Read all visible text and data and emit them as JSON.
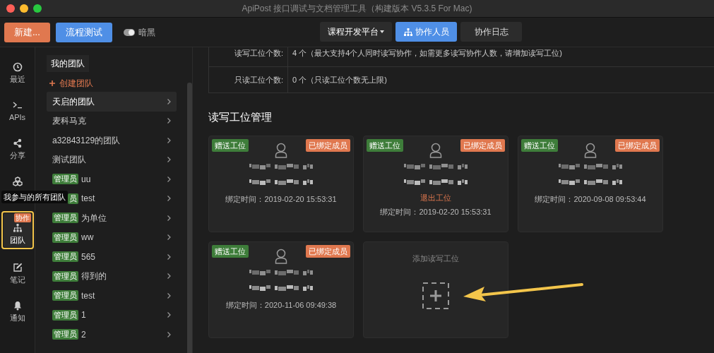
{
  "window": {
    "title": "ApiPost 接口调试与文档管理工具（构建版本 V5.3.5 For Mac)"
  },
  "toolbar": {
    "new_button": "新建...",
    "flow_button": "流程测试",
    "dark_toggle": {
      "label": "暗黑",
      "on": true
    },
    "project_select": "课程开发平台",
    "tabs": [
      {
        "label": "协作人员",
        "selected": true
      },
      {
        "label": "协作日志",
        "selected": false
      }
    ]
  },
  "rail": [
    {
      "kind": "clock",
      "label": "最近",
      "selected": false
    },
    {
      "kind": "terminal",
      "label": "APIs",
      "selected": false
    },
    {
      "kind": "share",
      "label": "分享",
      "selected": false
    },
    {
      "kind": "cubes",
      "selected": false
    },
    {
      "kind": "team",
      "label": "团队",
      "badge": "协作",
      "selected": true,
      "highlighted": true
    },
    {
      "kind": "note",
      "label": "笔记",
      "selected": false
    },
    {
      "kind": "bell",
      "label": "通知",
      "selected": false
    }
  ],
  "tooltip": "我参与的所有团队",
  "team_panel": {
    "tab": "我的团队",
    "create": "创建团队",
    "items": [
      {
        "name": "天启的团队",
        "selected": true
      },
      {
        "name": "麦科马克",
        "selected": false
      },
      {
        "name": "a32843129的团队",
        "selected": false
      },
      {
        "name": "测试团队",
        "selected": false
      },
      {
        "badge": "管理员",
        "name": "uu",
        "selected": false
      },
      {
        "badge": "员",
        "name": "test",
        "selected": false
      },
      {
        "badge": "管理员",
        "name": "为单位",
        "selected": false
      },
      {
        "badge": "管理员",
        "name": "ww",
        "selected": false
      },
      {
        "badge": "管理员",
        "name": "565",
        "selected": false
      },
      {
        "badge": "管理员",
        "name": "得到的",
        "selected": false
      },
      {
        "badge": "管理员",
        "name": "test",
        "selected": false
      },
      {
        "badge": "管理员",
        "name": "1",
        "selected": false
      },
      {
        "badge": "管理员",
        "name": "2",
        "selected": false
      }
    ]
  },
  "info_rows": [
    {
      "label": "读写工位个数:",
      "value": "4 个（最大支持4个人同时读写协作，如需更多读写协作人数，请增加读写工位)"
    },
    {
      "label": "只读工位个数:",
      "value": "0 个（只读工位个数无上限)"
    }
  ],
  "section_title": "读写工位管理",
  "seats": [
    {
      "kind": "member",
      "tag": "赠送工位",
      "status": "已绑定成员",
      "bound_time": "绑定时间：2019-02-20 15:53:31"
    },
    {
      "kind": "member",
      "tag": "赠送工位",
      "status": "已绑定成员",
      "action": "退出工位",
      "bound_time": "绑定时间：2019-02-20 15:53:31"
    },
    {
      "kind": "member",
      "tag": "赠送工位",
      "status": "已绑定成员",
      "bound_time": "绑定时间：2020-09-08 09:53:44"
    },
    {
      "kind": "member",
      "tag": "赠送工位",
      "status": "已绑定成员",
      "bound_time": "绑定时间：2020-11-06 09:49:38"
    },
    {
      "kind": "add",
      "label": "添加读写工位"
    }
  ]
}
